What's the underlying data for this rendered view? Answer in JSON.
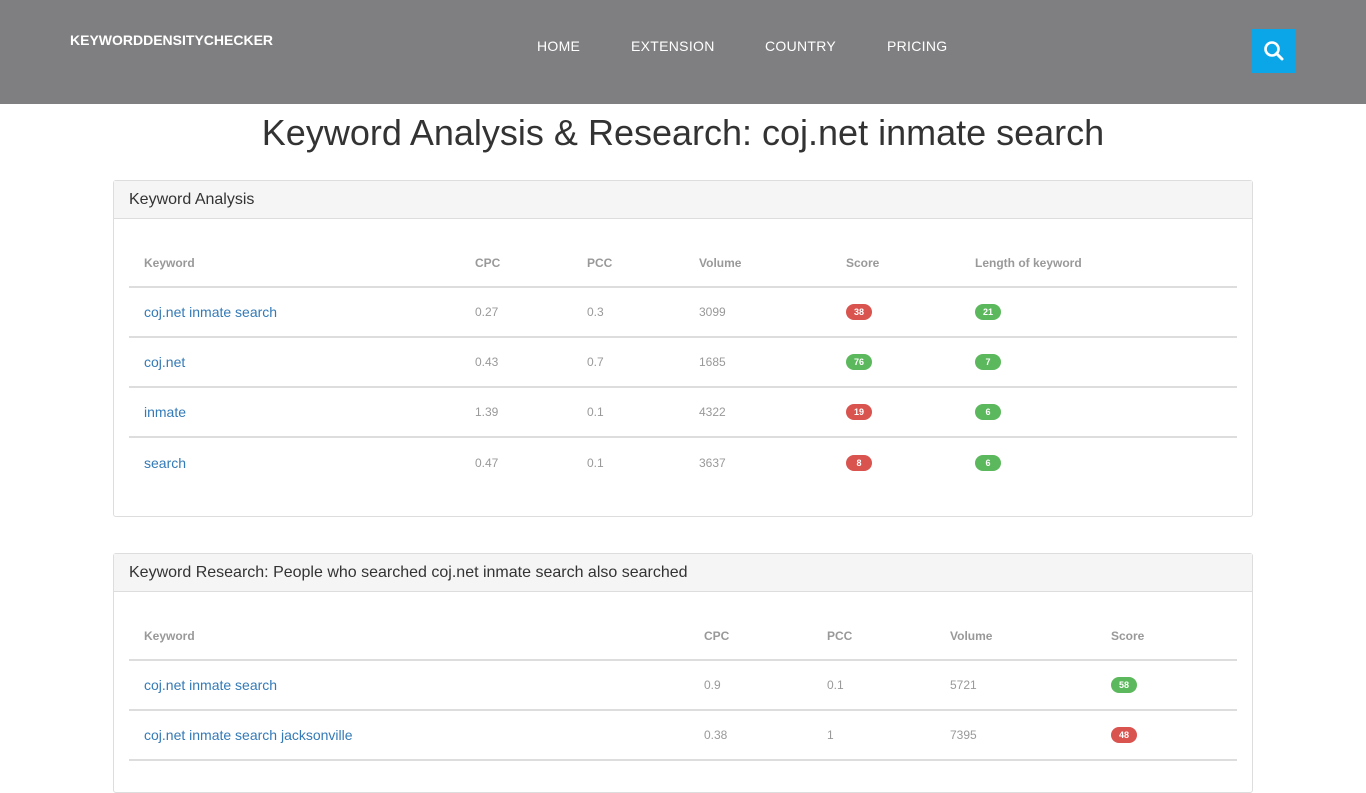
{
  "header": {
    "brand": "KEYWORDDENSITYCHECKER",
    "nav": [
      "HOME",
      "EXTENSION",
      "COUNTRY",
      "PRICING"
    ],
    "search_icon": "search-icon",
    "accent_color": "#0aa6e8"
  },
  "page_title": "Keyword Analysis & Research: coj.net inmate search",
  "analysis": {
    "heading": "Keyword Analysis",
    "columns": [
      "Keyword",
      "CPC",
      "PCC",
      "Volume",
      "Score",
      "Length of keyword"
    ],
    "rows": [
      {
        "keyword": "coj.net inmate search",
        "cpc": "0.27",
        "pcc": "0.3",
        "volume": "3099",
        "score": "38",
        "score_color": "red",
        "length": "21",
        "length_color": "green"
      },
      {
        "keyword": "coj.net",
        "cpc": "0.43",
        "pcc": "0.7",
        "volume": "1685",
        "score": "76",
        "score_color": "green",
        "length": "7",
        "length_color": "green"
      },
      {
        "keyword": "inmate",
        "cpc": "1.39",
        "pcc": "0.1",
        "volume": "4322",
        "score": "19",
        "score_color": "red",
        "length": "6",
        "length_color": "green"
      },
      {
        "keyword": "search",
        "cpc": "0.47",
        "pcc": "0.1",
        "volume": "3637",
        "score": "8",
        "score_color": "red",
        "length": "6",
        "length_color": "green"
      }
    ]
  },
  "research": {
    "heading": "Keyword Research: People who searched coj.net inmate search also searched",
    "columns": [
      "Keyword",
      "CPC",
      "PCC",
      "Volume",
      "Score"
    ],
    "rows": [
      {
        "keyword": "coj.net inmate search",
        "cpc": "0.9",
        "pcc": "0.1",
        "volume": "5721",
        "score": "58",
        "score_color": "green"
      },
      {
        "keyword": "coj.net inmate search jacksonville",
        "cpc": "0.38",
        "pcc": "1",
        "volume": "7395",
        "score": "48",
        "score_color": "red"
      }
    ]
  }
}
